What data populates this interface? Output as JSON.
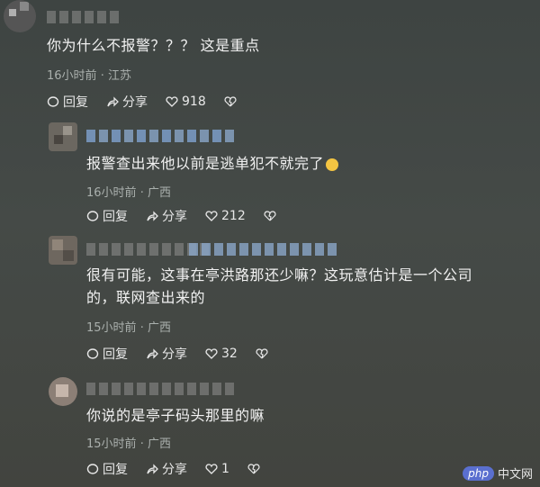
{
  "comments": [
    {
      "text": "你为什么不报警？？？ 这是重点",
      "time": "16小时前",
      "location": "江苏",
      "reply_label": "回复",
      "share_label": "分享",
      "likes": "918"
    },
    {
      "text": "报警查出来他以前是逃单犯不就完了",
      "time": "16小时前",
      "location": "广西",
      "reply_label": "回复",
      "share_label": "分享",
      "likes": "212"
    },
    {
      "text_line1": "很有可能，这事在亭洪路那还少嘛？这玩意估计是一个公司",
      "text_line2": "的，联网查出来的",
      "time": "15小时前",
      "location": "广西",
      "reply_label": "回复",
      "share_label": "分享",
      "likes": "32"
    },
    {
      "text": "你说的是亭子码头那里的嘛",
      "time": "15小时前",
      "location": "广西",
      "reply_label": "回复",
      "share_label": "分享",
      "likes": "1"
    }
  ],
  "separator": "·",
  "watermark": {
    "logo": "php",
    "text": "中文网"
  }
}
